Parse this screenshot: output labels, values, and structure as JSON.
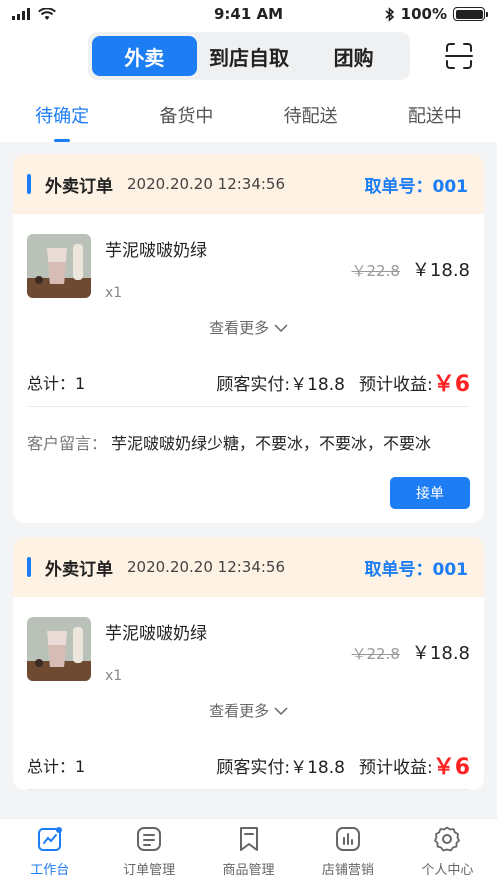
{
  "status_bar": {
    "time": "9:41 AM",
    "battery": "100%"
  },
  "header": {
    "modes": [
      "外卖",
      "到店自取",
      "团购"
    ],
    "active_mode": 0
  },
  "tabs": [
    "待确定",
    "备货中",
    "待配送",
    "配送中"
  ],
  "orders": [
    {
      "type": "外卖订单",
      "time": "2020.20.20 12:34:56",
      "pickup": "取单号：001",
      "item_name": "芋泥啵啵奶绿",
      "qty": "x1",
      "old_price": "￥22.8",
      "price": "￥18.8",
      "more": "查看更多",
      "total": "总计：1",
      "paid": "顾客实付:￥18.8",
      "income_label": "预计收益:",
      "income": "￥6",
      "remark_label": "客户留言：",
      "remark": "芋泥啵啵奶绿少糖，不要冰，不要冰，不要冰",
      "accept": "接单"
    },
    {
      "type": "外卖订单",
      "time": "2020.20.20 12:34:56",
      "pickup": "取单号：001",
      "item_name": "芋泥啵啵奶绿",
      "qty": "x1",
      "old_price": "￥22.8",
      "price": "￥18.8",
      "more": "查看更多",
      "total": "总计：1",
      "paid": "顾客实付:￥18.8",
      "income_label": "预计收益:",
      "income": "￥6"
    }
  ],
  "bottom_nav": [
    {
      "label": "工作台",
      "icon": "workbench-icon"
    },
    {
      "label": "订单管理",
      "icon": "order-icon"
    },
    {
      "label": "商品管理",
      "icon": "product-icon"
    },
    {
      "label": "店铺营销",
      "icon": "marketing-icon"
    },
    {
      "label": "个人中心",
      "icon": "settings-icon"
    }
  ],
  "colors": {
    "accent": "#1d7df4",
    "income": "#ff2222",
    "card_header": "#fdf2e3"
  }
}
